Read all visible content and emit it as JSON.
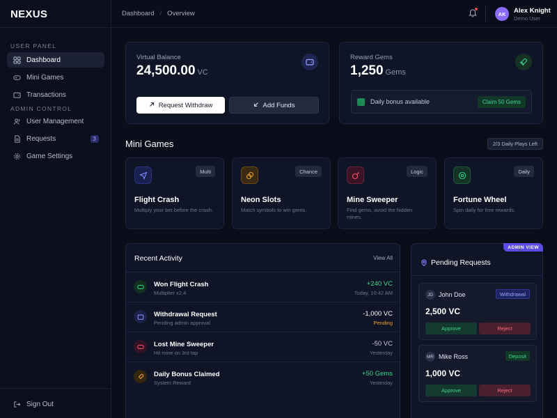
{
  "app": {
    "name": "NEXUS"
  },
  "sidebar": {
    "user_section": "USER PANEL",
    "admin_section": "ADMIN CONTROL",
    "items": [
      {
        "label": "Dashboard",
        "icon": "grid-icon"
      },
      {
        "label": "Mini Games",
        "icon": "gamepad-icon"
      },
      {
        "label": "Transactions",
        "icon": "wallet-icon"
      },
      {
        "label": "User Management",
        "icon": "users-icon"
      },
      {
        "label": "Requests",
        "icon": "file-icon",
        "count": "3"
      },
      {
        "label": "Game Settings",
        "icon": "gear-icon"
      }
    ],
    "signout": "Sign Out"
  },
  "header": {
    "crumb1": "Dashboard",
    "crumb_sep": "/",
    "crumb2": "Overview",
    "avatar_initials": "AK",
    "user_name": "Alex Knight",
    "user_role": "Demo User"
  },
  "balance": {
    "label": "Virtual Balance",
    "value": "24,500.00",
    "unit": "VC",
    "withdraw_label": "Request Withdraw",
    "add_label": "Add Funds"
  },
  "gems": {
    "label": "Reward Gems",
    "value": "1,250",
    "unit": "Gems",
    "bonus_text": "Daily bonus available",
    "claim_label": "Claim 50 Gems"
  },
  "mini_games": {
    "title": "Mini Games",
    "plays": "2/3 Daily Plays Left",
    "games": [
      {
        "name": "Flight Crash",
        "tag": "Multi",
        "desc": "Multiply your bet before the crash.",
        "color": "#5b6cff"
      },
      {
        "name": "Neon Slots",
        "tag": "Chance",
        "desc": "Match symbols to win gems.",
        "color": "#f0a030"
      },
      {
        "name": "Mine Sweeper",
        "tag": "Logic",
        "desc": "Find gems, avoid the hidden mines.",
        "color": "#ff4d6d"
      },
      {
        "name": "Fortune Wheel",
        "tag": "Daily",
        "desc": "Spin daily for free rewards.",
        "color": "#2ed08b"
      }
    ]
  },
  "activity": {
    "title": "Recent Activity",
    "view_all": "View All",
    "rows": [
      {
        "name": "Won Flight Crash",
        "sub": "Multiplier x2.4",
        "amount": "+240 VC",
        "meta": "Today, 10:42 AM",
        "color": "#3fd68a"
      },
      {
        "name": "Withdrawal Request",
        "sub": "Pending admin approval",
        "amount": "-1,000 VC",
        "meta": "Pending",
        "color": "#ffffff"
      },
      {
        "name": "Lost Mine Sweeper",
        "sub": "Hit mine on 3rd tap",
        "amount": "-50 VC",
        "meta": "Yesterday",
        "color": "#c5cad9"
      },
      {
        "name": "Daily Bonus Claimed",
        "sub": "System Reward",
        "amount": "+50 Gems",
        "meta": "Yesterday",
        "color": "#3fd68a"
      }
    ]
  },
  "pending": {
    "badge": "ADMIN VIEW",
    "title": "Pending Requests",
    "requests": [
      {
        "initials": "JD",
        "name": "John Doe",
        "type": "Withdrawal",
        "amount": "2,500 VC",
        "approve": "Approve",
        "reject": "Reject"
      },
      {
        "initials": "MR",
        "name": "Mike Ross",
        "type": "Deposit",
        "amount": "1,000 VC",
        "approve": "Approve",
        "reject": "Reject"
      }
    ]
  }
}
